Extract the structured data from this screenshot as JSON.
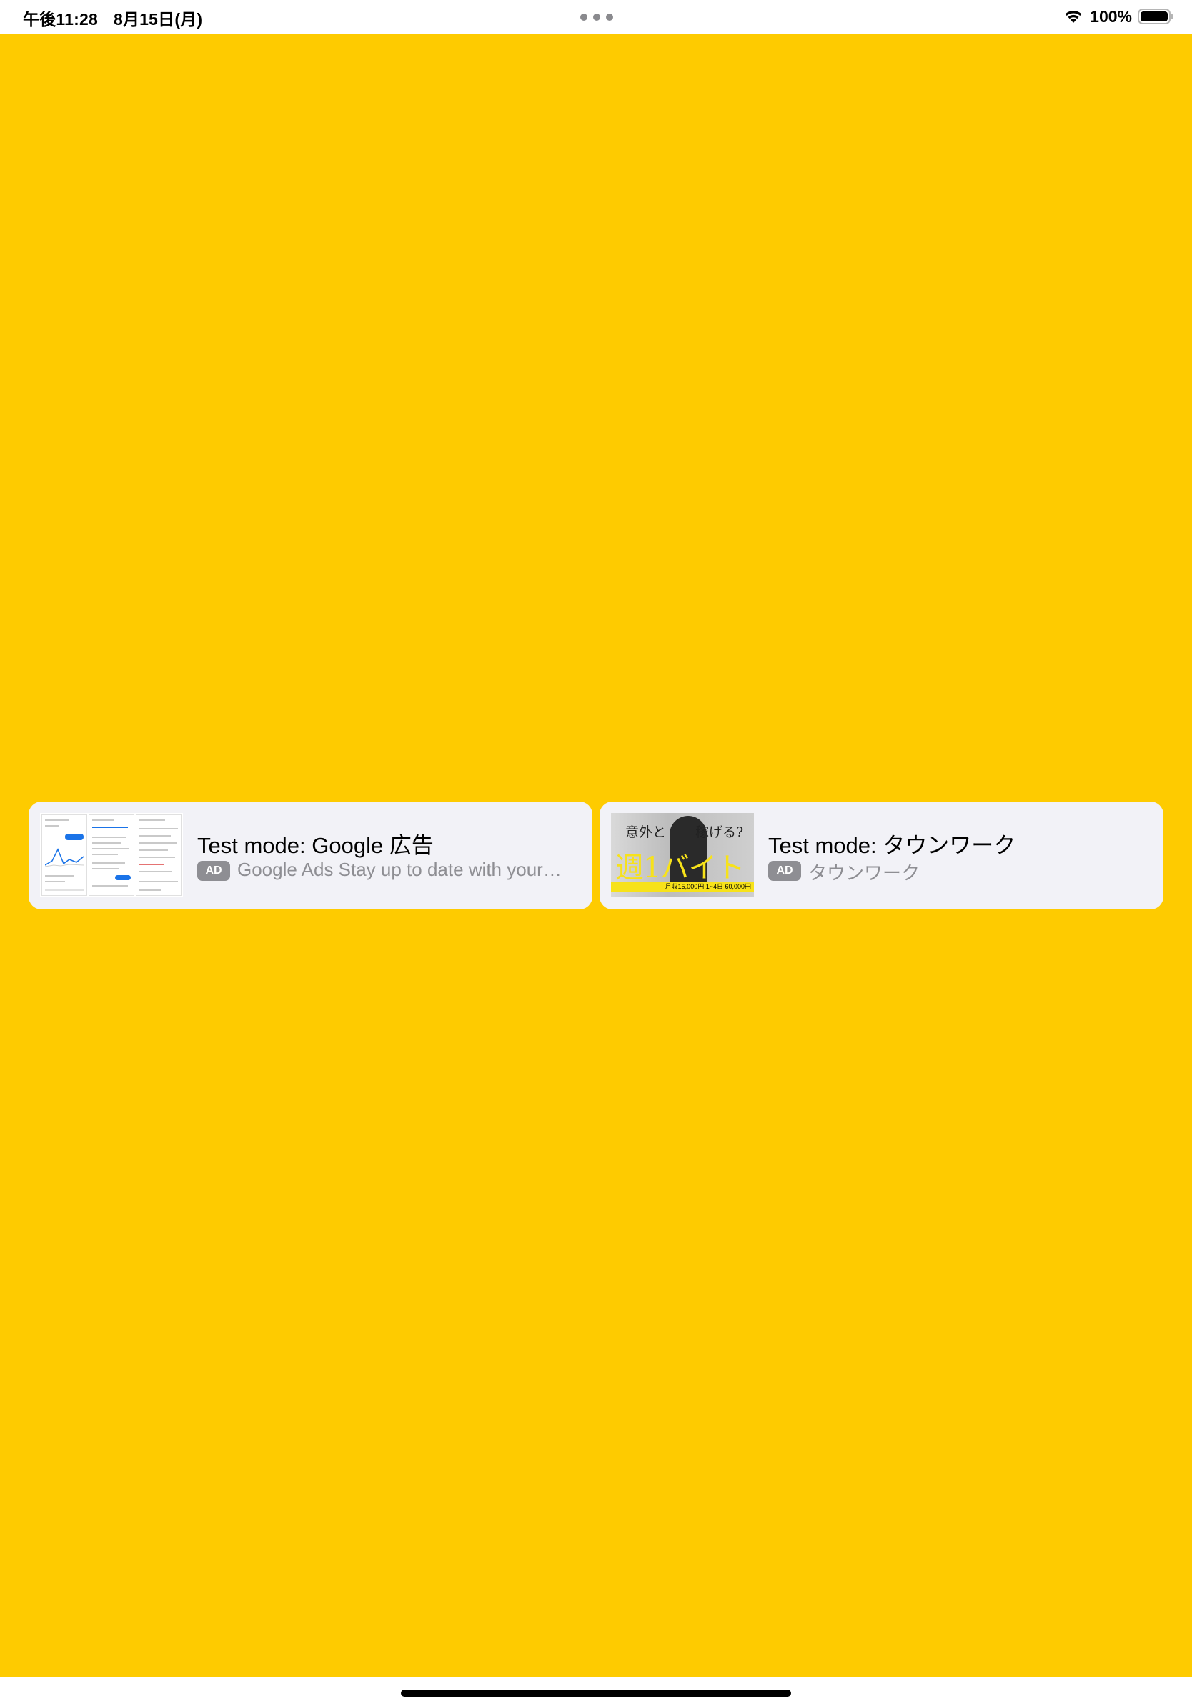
{
  "status_bar": {
    "time": "午後11:28",
    "date": "8月15日(月)",
    "battery_percent": "100%",
    "battery_level": 1.0,
    "icons": [
      "wifi-icon",
      "battery-icon",
      "multitask-dots-icon"
    ]
  },
  "colors": {
    "background": "#FECB00",
    "card": "#f2f2f7",
    "badge": "#8e8e93",
    "secondary_text": "#8e8e93"
  },
  "ads": [
    {
      "title": "Test mode: Google 広告",
      "badge": "AD",
      "description": "Google Ads Stay up to date with your…",
      "thumbnail": "google-ads-app-screenshot"
    },
    {
      "title": "Test mode: タウンワーク",
      "badge": "AD",
      "description": "タウンワーク",
      "thumbnail": "townwork-banner",
      "thumbnail_text": {
        "left_top": "意外と",
        "right_top": "稼げる?",
        "headline": "週1バイト",
        "footer": "月収15,000円 1~4日 60,000円"
      }
    }
  ]
}
